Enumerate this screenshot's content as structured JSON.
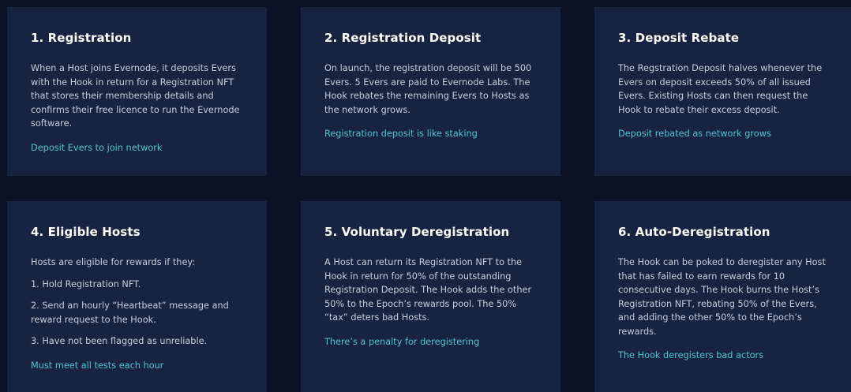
{
  "cards": [
    {
      "title": "1. Registration",
      "paragraphs": [
        "When a Host joins Evernode, it deposits Evers with the Hook in return for a Registration NFT that stores their membership details and confirms their free licence to run the Evernode software."
      ],
      "link": "Deposit Evers to join network"
    },
    {
      "title": "2. Registration Deposit",
      "paragraphs": [
        "On launch, the registration deposit will be 500 Evers. 5 Evers are paid to Evernode Labs. The Hook rebates the remaining Evers to Hosts as the network grows."
      ],
      "link": "Registration deposit is like staking"
    },
    {
      "title": "3. Deposit Rebate",
      "paragraphs": [
        "The Regstration Deposit halves whenever the Evers on deposit exceeds 50% of all issued Evers. Existing Hosts can then request the Hook to rebate their excess deposit."
      ],
      "link": "Deposit rebated as network grows"
    },
    {
      "title": "4. Eligible Hosts",
      "paragraphs": [
        "Hosts are eligible for rewards if they:",
        "1. Hold Registration NFT.",
        "2. Send an hourly “Heartbeat” message and reward request to the Hook.",
        "3. Have not been flagged as unreliable."
      ],
      "link": "Must meet all tests each hour"
    },
    {
      "title": "5. Voluntary Deregistration",
      "paragraphs": [
        "A Host can return its Registration NFT to the Hook in return for 50% of the outstanding Registration Deposit. The Hook adds the other 50% to the Epoch’s rewards pool. The 50% “tax” deters bad Hosts."
      ],
      "link": "There’s a penalty for deregistering"
    },
    {
      "title": "6. Auto-Deregistration",
      "paragraphs": [
        "The Hook can be poked to deregister any Host that has failed to earn rewards for 10 consecutive days. The Hook burns the Host’s Registration NFT, rebating 50% of the Evers, and adding the other 50% to the Epoch’s rewards."
      ],
      "link": "The Hook deregisters bad actors"
    }
  ]
}
